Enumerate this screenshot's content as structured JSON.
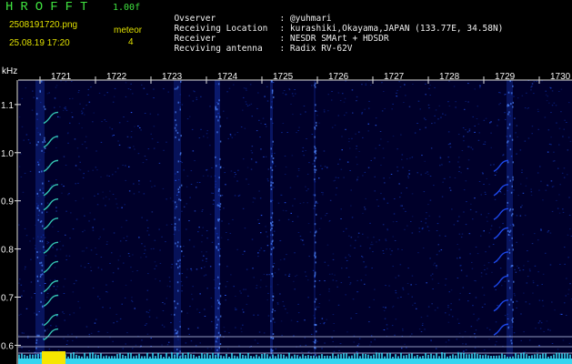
{
  "header": {
    "app_title": "HROFFT",
    "version": "1.00f",
    "filename": "2508191720.png",
    "datetime": "25.08.19 17:20",
    "mode": "meteor",
    "count": "4"
  },
  "station_info": [
    {
      "label": "Ovserver",
      "value": ": @yuhmari"
    },
    {
      "label": "Receiving Location",
      "value": ": kurashiki,Okayama,JAPAN (133.77E, 34.58N)"
    },
    {
      "label": "Receiver",
      "value": ": NESDR SMArt + HDSDR"
    },
    {
      "label": "Recviving antenna",
      "value": ": Radix RV-62V"
    }
  ],
  "spectrogram": {
    "freq_unit": "kHz",
    "time_ticks": [
      "1721",
      "1722",
      "1723",
      "1724",
      "1725",
      "1726",
      "1727",
      "1728",
      "1729",
      "1730"
    ],
    "freq_ticks": [
      "1.1",
      "1.0",
      "0.9",
      "0.8",
      "0.7",
      "0.6"
    ],
    "freq_range": [
      0.58,
      1.19
    ],
    "colors": {
      "background": "#00002a",
      "signal": "#2050ff",
      "strong": "#39d7c0",
      "grid": "#aab2d8",
      "baseline": "#35d5f0",
      "peak": "#f6e600"
    }
  }
}
